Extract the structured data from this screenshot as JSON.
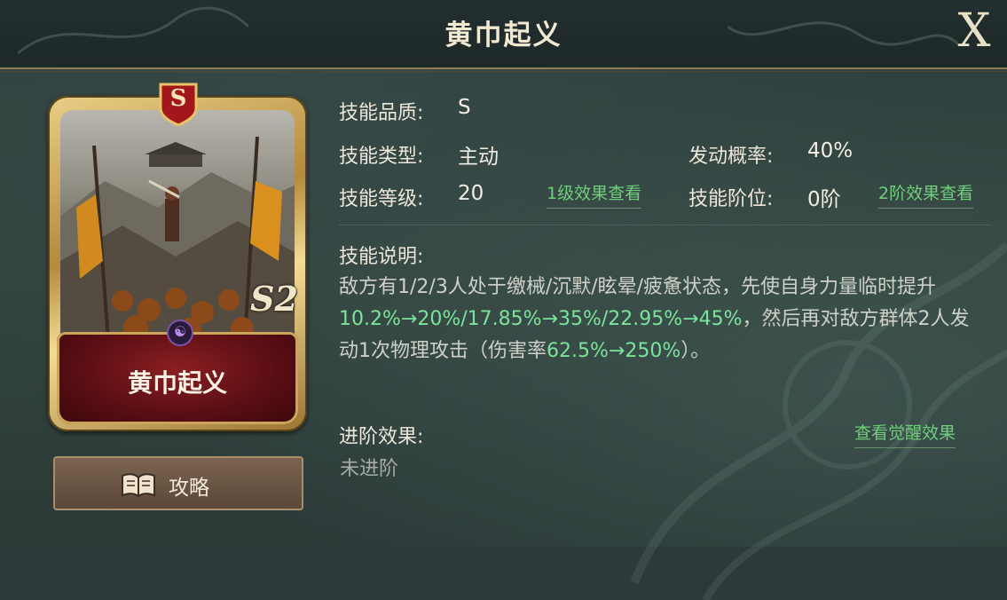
{
  "header": {
    "title": "黄巾起义",
    "close_label": "X"
  },
  "card": {
    "grade_letter": "S",
    "level_text": "S2",
    "name": "黄巾起义",
    "emblem_icon": "faction-emblem-icon"
  },
  "guide_button": {
    "label": "攻略",
    "icon": "book-icon"
  },
  "info": {
    "quality_label": "技能品质:",
    "quality_value": "S",
    "type_label": "技能类型:",
    "type_value": "主动",
    "rate_label": "发动概率:",
    "rate_value": "40%",
    "level_label": "技能等级:",
    "level_value": "20",
    "level_link": "1级效果查看",
    "rank_label": "技能阶位:",
    "rank_value": "0阶",
    "rank_link": "2阶效果查看"
  },
  "description": {
    "label": "技能说明:",
    "parts": [
      "敌方有1/2/3人处于缴械/沉默/眩晕/疲惫状态，先使自身力量临时提升",
      "10.2%→20%/17.85%→35%/22.95%→45%",
      "，然后再对敌方群体2人发动1次物理攻击（伤害率",
      "62.5%→250%",
      "）。"
    ]
  },
  "advance": {
    "label": "进阶效果:",
    "value": "未进阶",
    "link": "查看觉醒效果"
  },
  "colors": {
    "highlight": "#7be39a",
    "link": "#6fcf7a",
    "title": "#f1e9d2"
  }
}
